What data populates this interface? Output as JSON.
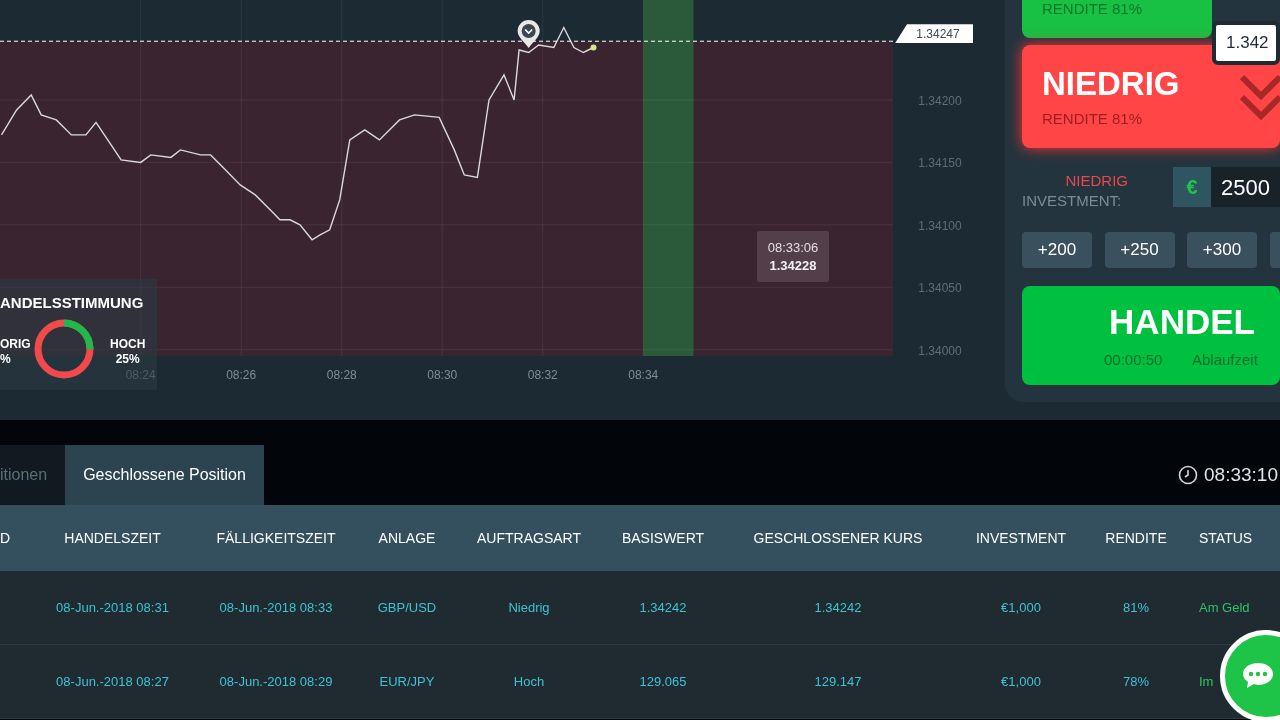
{
  "chart": {
    "chart_data": {
      "type": "line",
      "grid": true,
      "ref_lines": [
        {
          "axis": "y",
          "value": 1.34247
        }
      ],
      "bands": [
        {
          "axis": "y",
          "from": 1.33995,
          "to": 1.34247,
          "color": "#3a2430"
        },
        {
          "axis": "x",
          "from": 514,
          "to": 515,
          "color": "#2b5a3a"
        }
      ],
      "xlim": [
        501.2,
        518.97
      ],
      "ylim": [
        1.33995,
        1.3428
      ],
      "xticks": [
        {
          "value": 504,
          "label": "08:24"
        },
        {
          "value": 506,
          "label": "08:26"
        },
        {
          "value": 508,
          "label": "08:28"
        },
        {
          "value": 510,
          "label": "08:30"
        },
        {
          "value": 512,
          "label": "08:32"
        },
        {
          "value": 514,
          "label": "08:34"
        }
      ],
      "yticks": [
        {
          "value": 1.342,
          "label": "1.34200"
        },
        {
          "value": 1.3415,
          "label": "1.34150"
        },
        {
          "value": 1.341,
          "label": "1.34100"
        },
        {
          "value": 1.3405,
          "label": "1.34050"
        },
        {
          "value": 1.34,
          "label": "1.34000"
        }
      ],
      "x": [
        501.23,
        501.53,
        501.82,
        502.02,
        502.32,
        502.62,
        502.91,
        503.11,
        503.41,
        503.61,
        504.0,
        504.2,
        504.6,
        504.79,
        505.19,
        505.39,
        505.69,
        505.98,
        506.28,
        506.58,
        506.77,
        506.97,
        507.17,
        507.41,
        507.57,
        507.76,
        507.96,
        508.16,
        508.46,
        508.75,
        509.15,
        509.45,
        509.94,
        510.24,
        510.44,
        510.7,
        510.93,
        511.23,
        511.43,
        511.53,
        511.72,
        511.92,
        512.22,
        512.42,
        512.62,
        512.81,
        513.01
      ],
      "series": [
        {
          "color": "#d9d9d9",
          "values": [
            1.34172,
            1.34192,
            1.34204,
            1.34188,
            1.34184,
            1.34172,
            1.34172,
            1.34182,
            1.34164,
            1.34152,
            1.3415,
            1.34156,
            1.34154,
            1.3416,
            1.34156,
            1.34156,
            1.34144,
            1.34132,
            1.34124,
            1.34112,
            1.34104,
            1.34104,
            1.341,
            1.34088,
            1.34092,
            1.34096,
            1.3412,
            1.34168,
            1.34176,
            1.34168,
            1.34184,
            1.34188,
            1.34186,
            1.3416,
            1.3414,
            1.34138,
            1.342,
            1.3422,
            1.342,
            1.3424,
            1.34238,
            1.34244,
            1.34242,
            1.34258,
            1.34242,
            1.34238,
            1.34242
          ]
        }
      ]
    },
    "strike_price": "1.34247",
    "tooltip": {
      "time": "08:33:06",
      "price": "1.34228"
    },
    "sentiment": {
      "title": "ANDELSSTIMMUNG",
      "low_label": "ORIG",
      "low_value": "%",
      "high_label": "HOCH",
      "high_value": "25%",
      "level": 0.25
    }
  },
  "trade_panel": {
    "high_card": {
      "return": "RENDITE 81%"
    },
    "price_box": "1.342",
    "low_card": {
      "title": "NIEDRIG",
      "return": "RENDITE 81%"
    },
    "direction": "NIEDRIG",
    "investment_label": "INVESTMENT:",
    "currency": "€",
    "amount": "2500",
    "presets": [
      "+200",
      "+250",
      "+300"
    ],
    "trade_button": {
      "title": "HANDEL",
      "countdown": "00:00:50",
      "caption": "Ablaufzeit"
    }
  },
  "tabs": [
    {
      "label": "itionen",
      "selected": false
    },
    {
      "label": "Geschlossene Position",
      "selected": true
    }
  ],
  "clock": "08:33:10",
  "table": {
    "columns": [
      "D",
      "HANDELSZEIT",
      "FÄLLIGKEITSZEIT",
      "ANLAGE",
      "AUFTRAGSART",
      "BASISWERT",
      "GESCHLOSSENER KURS",
      "INVESTMENT",
      "RENDITE",
      "STATUS"
    ],
    "rows": [
      {
        "cells": [
          "",
          "08-Jun.-2018 08:31",
          "08-Jun.-2018 08:33",
          "GBP/USD",
          "Niedrig",
          "1.34242",
          "1.34242",
          "€1,000",
          "81%",
          "Am Geld"
        ]
      },
      {
        "cells": [
          "",
          "08-Jun.-2018 08:27",
          "08-Jun.-2018 08:29",
          "EUR/JPY",
          "Hoch",
          "129.065",
          "129.147",
          "€1,000",
          "78%",
          "Im"
        ]
      }
    ]
  }
}
